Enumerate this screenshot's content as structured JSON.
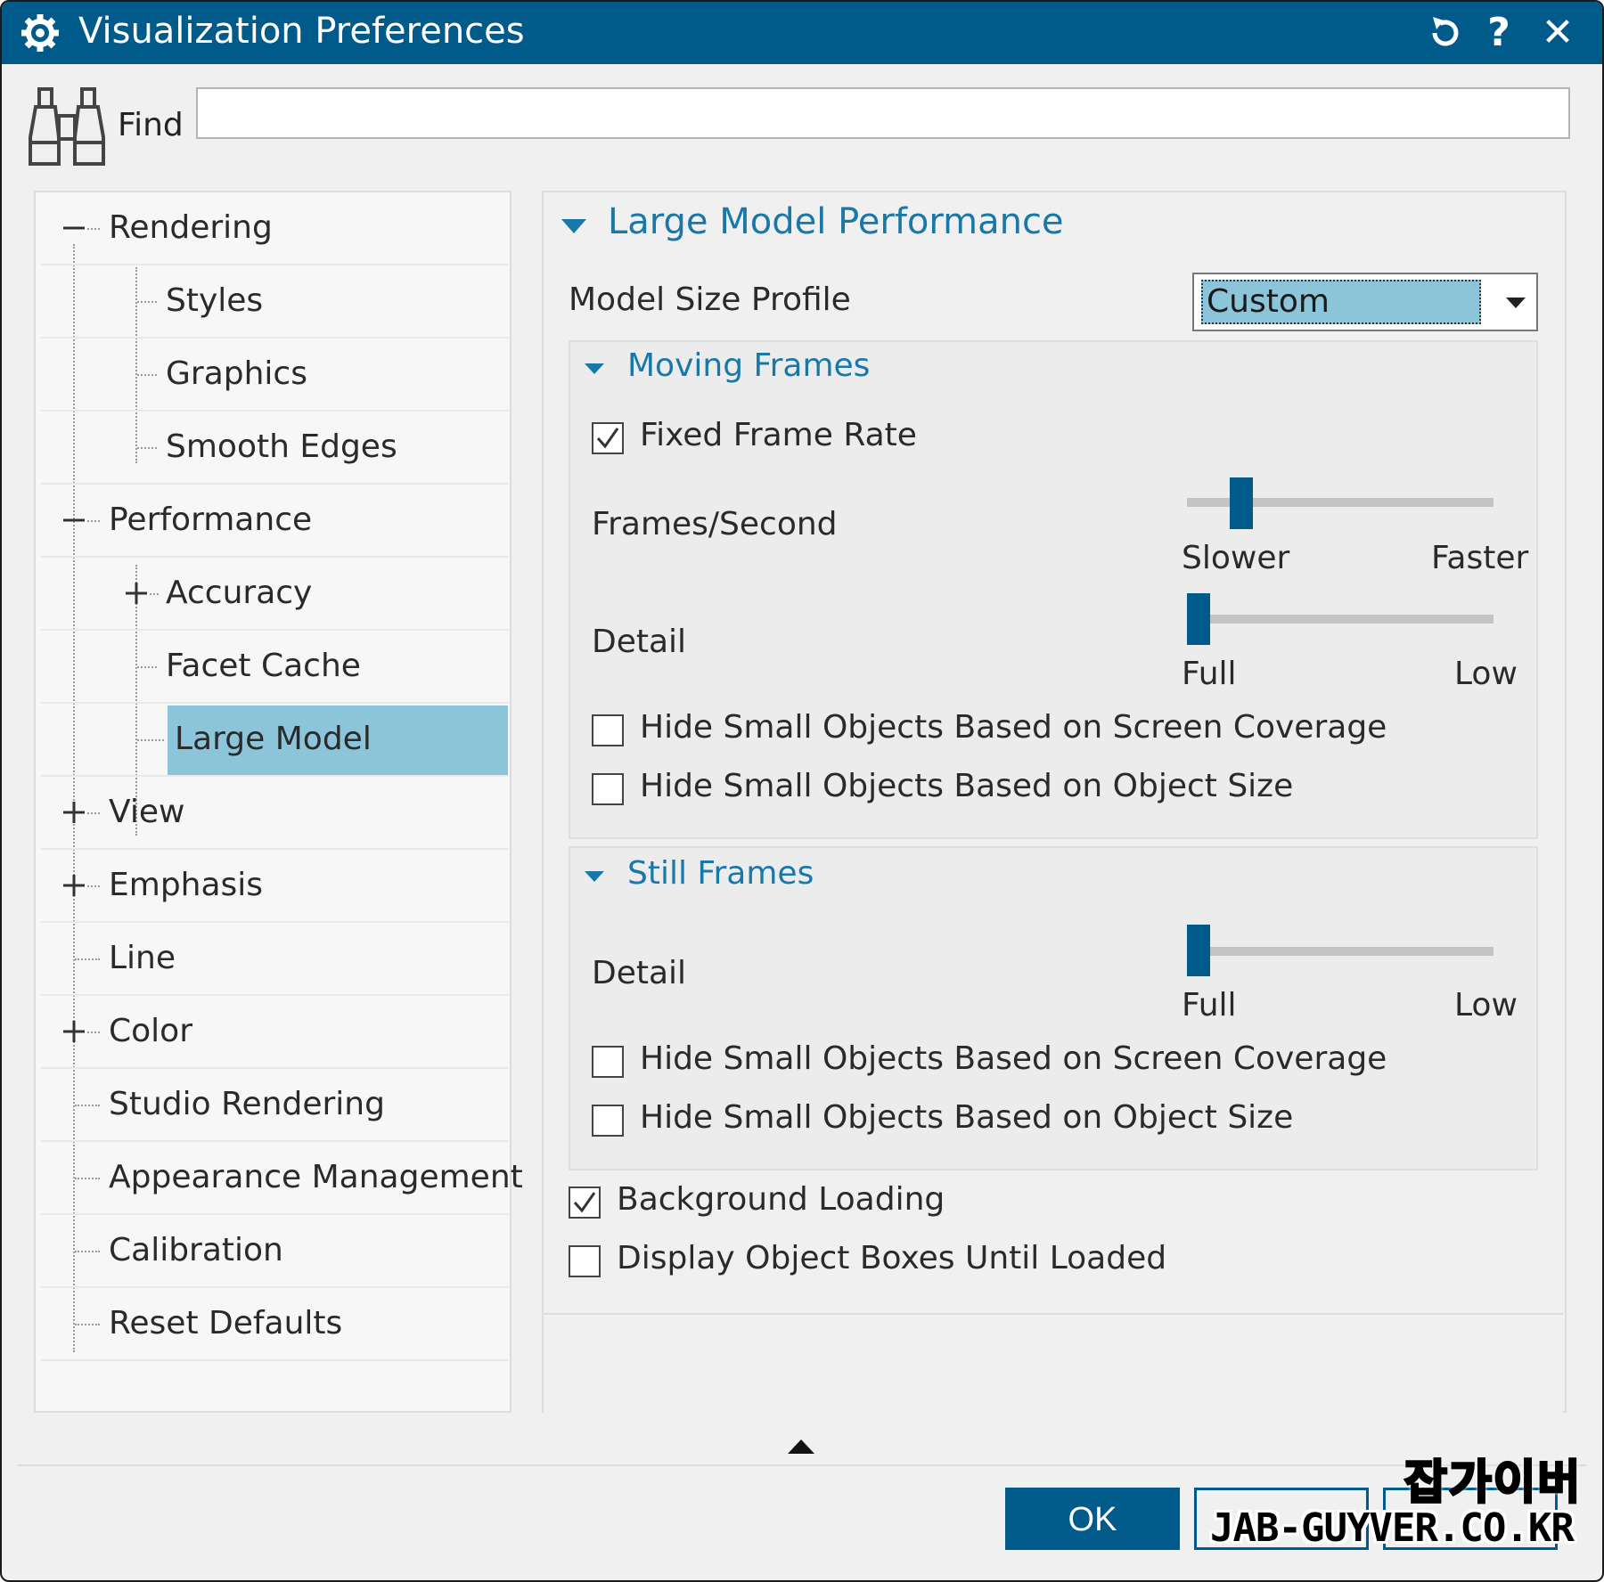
{
  "window": {
    "title": "Visualization Preferences",
    "buttons": {
      "reset": "reset-icon",
      "help": "?",
      "close": "✕"
    }
  },
  "find": {
    "label": "Find",
    "value": "",
    "placeholder": ""
  },
  "tree": {
    "items": [
      {
        "label": "Rendering",
        "expander": "minus"
      },
      {
        "label": "Styles"
      },
      {
        "label": "Graphics"
      },
      {
        "label": "Smooth Edges"
      },
      {
        "label": "Performance",
        "expander": "minus"
      },
      {
        "label": "Accuracy",
        "expander": "plus"
      },
      {
        "label": "Facet Cache"
      },
      {
        "label": "Large Model",
        "selected": true
      },
      {
        "label": "View",
        "expander": "plus"
      },
      {
        "label": "Emphasis",
        "expander": "plus"
      },
      {
        "label": "Line"
      },
      {
        "label": "Color",
        "expander": "plus"
      },
      {
        "label": "Studio Rendering"
      },
      {
        "label": "Appearance Management"
      },
      {
        "label": "Calibration"
      },
      {
        "label": "Reset Defaults"
      }
    ]
  },
  "panel": {
    "title": "Large Model Performance",
    "model_size_profile": {
      "label": "Model Size Profile",
      "value": "Custom"
    },
    "moving_frames": {
      "title": "Moving Frames",
      "fixed_frame_rate": {
        "label": "Fixed Frame Rate",
        "checked": true
      },
      "frames_per_second": {
        "label": "Frames/Second",
        "min_label": "Slower",
        "max_label": "Faster",
        "value": 0.15
      },
      "detail": {
        "label": "Detail",
        "min_label": "Full",
        "max_label": "Low",
        "value": 0.0
      },
      "hide_screen_coverage": {
        "label": "Hide Small Objects Based on Screen Coverage",
        "checked": false
      },
      "hide_object_size": {
        "label": "Hide Small Objects Based on Object Size",
        "checked": false
      }
    },
    "still_frames": {
      "title": "Still Frames",
      "detail": {
        "label": "Detail",
        "min_label": "Full",
        "max_label": "Low",
        "value": 0.0
      },
      "hide_screen_coverage": {
        "label": "Hide Small Objects Based on Screen Coverage",
        "checked": false
      },
      "hide_object_size": {
        "label": "Hide Small Objects Based on Object Size",
        "checked": false
      }
    },
    "background_loading": {
      "label": "Background Loading",
      "checked": true
    },
    "display_object_boxes": {
      "label": "Display Object Boxes Until Loaded",
      "checked": false
    }
  },
  "footer": {
    "ok_label": "OK"
  },
  "watermark": {
    "line1": "잡가이버",
    "line2": "JAB-GUYVER.CO.KR"
  },
  "colors": {
    "title_bar": "#005a8a",
    "selection": "#8cc5d9",
    "section_text": "#1878a8"
  }
}
